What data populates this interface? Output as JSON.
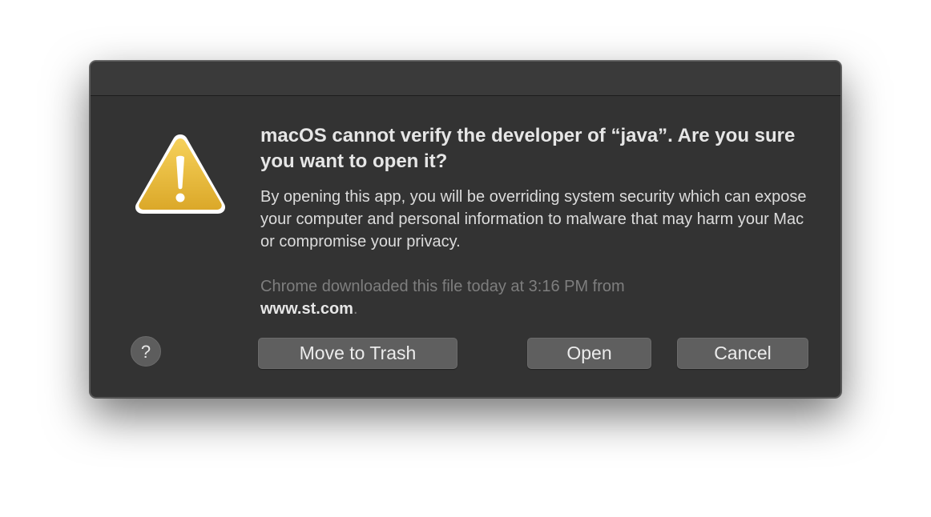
{
  "dialog": {
    "title": "macOS cannot verify the developer of “java”. Are you sure you want to open it?",
    "message": "By opening this app, you will be overriding system security which can expose your computer and personal information to malware that may harm your Mac or compromise your privacy.",
    "source_prefix": "Chrome downloaded this file today at 3:16 PM from",
    "source_domain": "www.st.com",
    "source_suffix": ".",
    "icon": "warning-triangle-icon",
    "colors": {
      "background": "#333333",
      "warning_yellow": "#e8b530",
      "button": "#5f5f5f"
    }
  },
  "buttons": {
    "help": "?",
    "move_to_trash": "Move to Trash",
    "open": "Open",
    "cancel": "Cancel"
  }
}
